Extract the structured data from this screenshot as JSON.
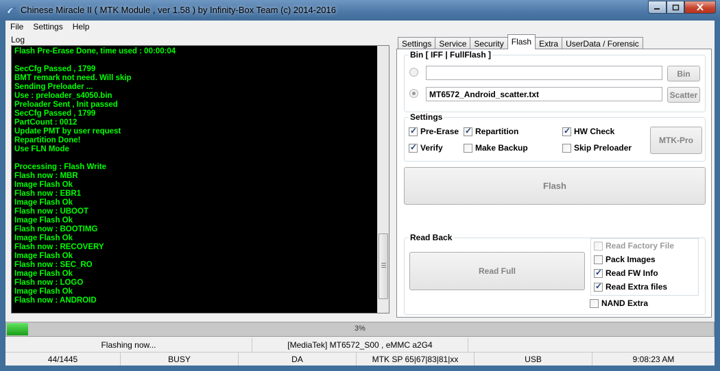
{
  "window": {
    "title": "Chinese Miracle II ( MTK Module , ver 1.58 ) by Infinity-Box Team (c) 2014-2016",
    "minimize_icon": "minimize-icon",
    "maximize_icon": "maximize-icon",
    "close_icon": "close-icon"
  },
  "menu": [
    "File",
    "Settings",
    "Help"
  ],
  "log": {
    "label": "Log",
    "lines": [
      "Flash Pre-Erase Done, time used : 00:00:04",
      "",
      "SecCfg Passed , 1799",
      "BMT remark not need. Will skip",
      "Sending Preloader ...",
      "Use : preloader_s4050.bin",
      "Preloader Sent , Init passed",
      "SecCfg Passed , 1799",
      "PartCount : 0012",
      "Update PMT by user request",
      "Repartition Done!",
      "Use FLN Mode",
      "",
      "Processing : Flash Write",
      "Flash now : MBR",
      "Image Flash Ok",
      "Flash now : EBR1",
      "Image Flash Ok",
      "Flash now : UBOOT",
      "Image Flash Ok",
      "Flash now : BOOTIMG",
      "Image Flash Ok",
      "Flash now : RECOVERY",
      "Image Flash Ok",
      "Flash now : SEC_RO",
      "Image Flash Ok",
      "Flash now : LOGO",
      "Image Flash Ok",
      "Flash now : ANDROID"
    ]
  },
  "tabs": [
    "Settings",
    "Service",
    "Security",
    "Flash",
    "Extra",
    "UserData / Forensic"
  ],
  "active_tab": "Flash",
  "bin": {
    "legend": "Bin  [ IFF | FullFlash ]",
    "path1": "",
    "path2": "MT6572_Android_scatter.txt",
    "bin_button": "Bin",
    "scatter_button": "Scatter"
  },
  "settings": {
    "legend": "Settings",
    "pre_erase": "Pre-Erase",
    "repartition": "Repartition",
    "hw_check": "HW Check",
    "verify": "Verify",
    "make_backup": "Make Backup",
    "skip_preloader": "Skip Preloader",
    "mtk_pro_button": "MTK-Pro"
  },
  "flash_button": "Flash",
  "readback": {
    "legend": "Read Back",
    "read_full_button": "Read Full",
    "read_factory_file": "Read Factory File",
    "pack_images": "Pack Images",
    "read_fw_info": "Read FW Info",
    "read_extra_files": "Read Extra files",
    "nand_extra": "NAND Extra"
  },
  "progress": {
    "percent": 3,
    "text": "3%",
    "color": "#1aa01a"
  },
  "status1": [
    "Flashing now...",
    "[MediaTek] MT6572_S00 , eMMC a2G4",
    ""
  ],
  "status2": [
    "44/1445",
    "BUSY",
    "DA",
    "MTK SP 65|67|83|81|xx",
    "USB",
    "9:08:23 AM"
  ]
}
